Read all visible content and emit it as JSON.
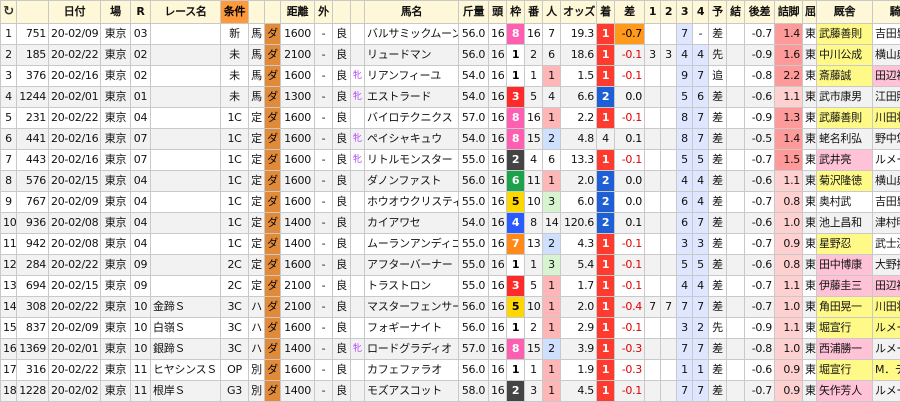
{
  "columns": [
    "C",
    "",
    "日付",
    "場",
    "R",
    "レース名",
    "条件",
    "",
    "",
    "距離",
    "外",
    "",
    "馬名",
    "斤量",
    "頭",
    "枠",
    "番",
    "人",
    "オッズ",
    "着",
    "差",
    "1",
    "2",
    "3",
    "4",
    "予",
    "結",
    "後差",
    "詰脚",
    "屈",
    "厩舎",
    "騎手"
  ],
  "rows": [
    [
      "1",
      "751",
      "20-02/09",
      "東京",
      "03",
      "",
      "新",
      "馬",
      "ダ",
      "1600",
      "-",
      "良",
      "",
      "バルサミックムーン",
      "56.0",
      "16",
      "8",
      "16",
      "7",
      "19.3",
      "1",
      "-0.7",
      "",
      "",
      "7",
      "-",
      "差",
      "-0.7",
      "1.4",
      "東",
      "武藤善則",
      "吉田豊"
    ],
    [
      "2",
      "185",
      "20-02/22",
      "東京",
      "02",
      "",
      "未",
      "馬",
      "ダ",
      "2100",
      "-",
      "良",
      "",
      "リュードマン",
      "56.0",
      "16",
      "1",
      "2",
      "6",
      "18.6",
      "1",
      "-0.1",
      "3",
      "3",
      "4",
      "4",
      "先",
      "-0.9",
      "1.6",
      "東",
      "中川公成",
      "横山典弘"
    ],
    [
      "3",
      "376",
      "20-02/16",
      "東京",
      "02",
      "",
      "未",
      "馬",
      "ダ",
      "1600",
      "-",
      "良",
      "牝",
      "リアンフィーユ",
      "54.0",
      "16",
      "1",
      "1",
      "1",
      "1.5",
      "1",
      "-0.1",
      "",
      "",
      "9",
      "7",
      "追",
      "-0.8",
      "2.2",
      "東",
      "斎藤誠",
      "田辺裕信"
    ],
    [
      "4",
      "1244",
      "20-02/01",
      "東京",
      "01",
      "",
      "未",
      "馬",
      "ダ",
      "1300",
      "-",
      "良",
      "牝",
      "エストラード",
      "54.0",
      "16",
      "3",
      "5",
      "4",
      "6.6",
      "2",
      "0.0",
      "",
      "",
      "5",
      "6",
      "差",
      "-0.6",
      "1.1",
      "東",
      "武市康男",
      "江田照男"
    ],
    [
      "5",
      "231",
      "20-02/22",
      "東京",
      "04",
      "",
      "1C",
      "定",
      "ダ",
      "1600",
      "-",
      "良",
      "",
      "バイロテクニクス",
      "57.0",
      "16",
      "8",
      "16",
      "1",
      "2.2",
      "1",
      "-0.1",
      "",
      "",
      "8",
      "7",
      "差",
      "-0.9",
      "1.3",
      "東",
      "武藤善則",
      "川田将雅"
    ],
    [
      "6",
      "441",
      "20-02/16",
      "東京",
      "07",
      "",
      "1C",
      "定",
      "ダ",
      "1600",
      "-",
      "良",
      "牝",
      "ペイシャキュウ",
      "54.0",
      "16",
      "8",
      "15",
      "2",
      "4.8",
      "4",
      "0.1",
      "",
      "",
      "8",
      "7",
      "差",
      "-0.5",
      "1.4",
      "東",
      "蛯名利弘",
      "野中悠太"
    ],
    [
      "7",
      "443",
      "20-02/16",
      "東京",
      "07",
      "",
      "1C",
      "定",
      "ダ",
      "1600",
      "-",
      "良",
      "牝",
      "リトルモンスター",
      "55.0",
      "16",
      "2",
      "4",
      "6",
      "13.3",
      "1",
      "-0.1",
      "",
      "",
      "5",
      "5",
      "差",
      "-0.7",
      "1.5",
      "東",
      "武井亮",
      "ルメール"
    ],
    [
      "8",
      "576",
      "20-02/15",
      "東京",
      "04",
      "",
      "1C",
      "定",
      "ダ",
      "1600",
      "-",
      "良",
      "",
      "ダノンファスト",
      "56.0",
      "16",
      "6",
      "11",
      "1",
      "2.0",
      "2",
      "0.0",
      "",
      "",
      "4",
      "4",
      "差",
      "-0.6",
      "1.1",
      "東",
      "菊沢隆徳",
      "横山典弘"
    ],
    [
      "9",
      "767",
      "20-02/09",
      "東京",
      "04",
      "",
      "1C",
      "定",
      "ダ",
      "1600",
      "-",
      "良",
      "",
      "ホウオウクリスティ",
      "55.0",
      "16",
      "5",
      "10",
      "3",
      "6.0",
      "2",
      "0.0",
      "",
      "",
      "6",
      "4",
      "差",
      "-0.7",
      "0.8",
      "東",
      "奥村武",
      "吉田豊"
    ],
    [
      "10",
      "936",
      "20-02/08",
      "東京",
      "04",
      "",
      "1C",
      "定",
      "ダ",
      "1400",
      "-",
      "良",
      "",
      "カイアワセ",
      "54.0",
      "16",
      "4",
      "8",
      "14",
      "120.6",
      "2",
      "0.1",
      "",
      "",
      "6",
      "7",
      "差",
      "-0.6",
      "1.0",
      "東",
      "池上昌和",
      "津村明秀"
    ],
    [
      "11",
      "942",
      "20-02/08",
      "東京",
      "04",
      "",
      "1C",
      "定",
      "ダ",
      "1400",
      "-",
      "良",
      "",
      "ムーランアンディゴ",
      "55.0",
      "16",
      "7",
      "13",
      "2",
      "4.3",
      "1",
      "-0.1",
      "",
      "",
      "3",
      "3",
      "差",
      "-0.7",
      "0.9",
      "東",
      "星野忍",
      "武士沢友"
    ],
    [
      "12",
      "284",
      "20-02/22",
      "東京",
      "09",
      "",
      "2C",
      "定",
      "ダ",
      "1600",
      "-",
      "良",
      "",
      "アフターバーナー",
      "55.0",
      "16",
      "1",
      "1",
      "3",
      "5.4",
      "1",
      "-0.1",
      "",
      "",
      "5",
      "5",
      "差",
      "-0.6",
      "0.8",
      "東",
      "田中博康",
      "大野拓弥"
    ],
    [
      "13",
      "694",
      "20-02/15",
      "東京",
      "09",
      "",
      "2C",
      "定",
      "ダ",
      "2100",
      "-",
      "良",
      "",
      "トラストロン",
      "55.0",
      "16",
      "3",
      "5",
      "1",
      "1.7",
      "1",
      "-0.1",
      "",
      "",
      "4",
      "4",
      "差",
      "-0.7",
      "1.1",
      "東",
      "伊藤圭三",
      "田辺裕信"
    ],
    [
      "14",
      "308",
      "20-02/22",
      "東京",
      "10",
      "金蹄Ｓ",
      "3C",
      "ハ",
      "ダ",
      "2100",
      "-",
      "良",
      "",
      "マスターフェンサー",
      "56.0",
      "16",
      "5",
      "10",
      "1",
      "2.0",
      "1",
      "-0.4",
      "7",
      "7",
      "7",
      "7",
      "差",
      "-0.7",
      "1.0",
      "東",
      "角田晃一",
      "川田将雅"
    ],
    [
      "15",
      "837",
      "20-02/09",
      "東京",
      "10",
      "白嶺Ｓ",
      "3C",
      "ハ",
      "ダ",
      "1600",
      "-",
      "良",
      "",
      "フォギーナイト",
      "56.0",
      "16",
      "1",
      "2",
      "1",
      "2.9",
      "1",
      "-0.1",
      "",
      "",
      "3",
      "2",
      "先",
      "-0.9",
      "1.1",
      "東",
      "堀宣行",
      "ルメール"
    ],
    [
      "16",
      "1369",
      "20-02/01",
      "東京",
      "10",
      "銀蹄Ｓ",
      "3C",
      "ハ",
      "ダ",
      "1400",
      "-",
      "良",
      "牝",
      "ロードグラディオ",
      "57.0",
      "16",
      "8",
      "15",
      "2",
      "3.9",
      "1",
      "-0.3",
      "",
      "",
      "7",
      "7",
      "差",
      "-0.8",
      "1.0",
      "東",
      "西浦勝一",
      "ルメール"
    ],
    [
      "17",
      "316",
      "20-02/22",
      "東京",
      "11",
      "ヒヤシンスＳ",
      "OP",
      "別",
      "ダ",
      "1600",
      "-",
      "良",
      "",
      "カフェファラオ",
      "56.0",
      "16",
      "1",
      "1",
      "1",
      "1.9",
      "1",
      "-0.3",
      "",
      "",
      "1",
      "1",
      "差",
      "-0.6",
      "0.9",
      "東",
      "堀宣行",
      "M．デム"
    ],
    [
      "18",
      "1228",
      "20-02/02",
      "東京",
      "11",
      "根岸Ｓ",
      "G3",
      "別",
      "ダ",
      "1400",
      "-",
      "良",
      "",
      "モズアスコット",
      "58.0",
      "16",
      "2",
      "3",
      "1",
      "4.5",
      "1",
      "-0.1",
      "",
      "",
      "7",
      "7",
      "差",
      "-0.7",
      "0.9",
      "東",
      "矢作芳人",
      "ルメール"
    ]
  ],
  "colors": {
    "frame1": "#ffffff",
    "frame2": "#444444",
    "frame3": "#ff2b2b",
    "frame4": "#2a5bff",
    "frame5": "#ffd700",
    "frame6": "#1aa34a",
    "frame7": "#ff8a1a",
    "frame8": "#ff5fb0"
  },
  "icons": {
    "reload": "reload-icon"
  }
}
